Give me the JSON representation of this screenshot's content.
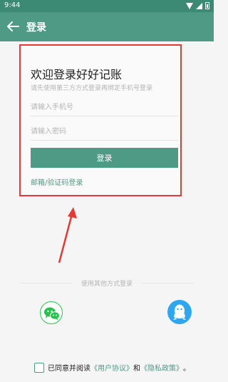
{
  "status_bar": {
    "time": "9:44"
  },
  "app_bar": {
    "title": "登录"
  },
  "login": {
    "welcome": "欢迎登录好好记账",
    "hint": "请先使用第三方方式登录再绑定手机号登录",
    "phone_placeholder": "请输入手机号",
    "password_placeholder": "请输入密码",
    "login_button": "登录",
    "alt_login": "邮箱/验证码登录"
  },
  "other_login": {
    "label": "使用其他方式登录"
  },
  "agreement": {
    "prefix": "已同意并阅读",
    "user_agreement": "《用户协议》",
    "and": "和",
    "privacy_policy": "《隐私政策》",
    "suffix": "。"
  },
  "colors": {
    "app_bar": "#4f9a84",
    "accent": "#4f9a84",
    "highlight": "#e53935",
    "wechat": "#26c24b",
    "qq": "#2ea6f0"
  },
  "icons": {
    "back": "back-arrow-icon",
    "wechat": "wechat-icon",
    "qq": "qq-icon"
  }
}
